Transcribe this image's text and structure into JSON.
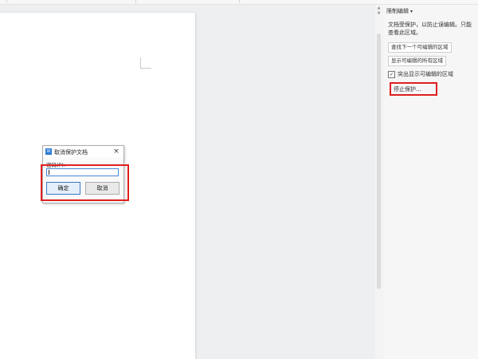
{
  "panel": {
    "title": "限制编辑",
    "title_chevron_icon": "chevron-down-icon",
    "description": "文档受保护，以防止误编辑。只能查看此区域。",
    "find_next_label": "查找下一个可编辑的区域",
    "show_all_label": "显示可编辑的所有区域",
    "highlight_label": "突出显示可编辑的区域",
    "highlight_checked": true,
    "stop_protection_label": "停止保护..."
  },
  "dialog": {
    "icon": "wps-writer-icon",
    "icon_glyph": "W",
    "title": "取消保护文档",
    "close_glyph": "×",
    "password_label": "密码(P):",
    "password_value": "",
    "ok_label": "确定",
    "cancel_label": "取消"
  },
  "scrollbar": {
    "up_glyph": "▲",
    "down_glyph": "▼"
  },
  "colors": {
    "highlight_box": "#e02020",
    "input_focus": "#4a86d8",
    "dialog_icon": "#2b79d6"
  }
}
